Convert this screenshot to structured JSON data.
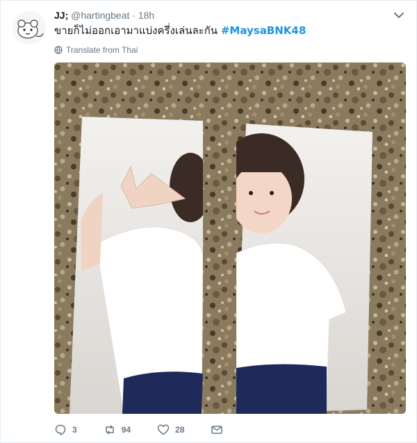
{
  "tweet": {
    "display_name": "JJ;",
    "handle": "@hartingbeat",
    "separator": "·",
    "time": "18h",
    "text": "ขายก็ไม่ออกเอามาแบ่งครึ่งเล่นละกัน",
    "hashtag": "#MaysaBNK48",
    "translate_label": "Translate from Thai",
    "media_description": "Two halves of a cut photo card of a girl in a white t-shirt posing with a peace sign, laid on granite countertop"
  },
  "actions": {
    "reply_count": "3",
    "retweet_count": "94",
    "like_count": "28"
  },
  "colors": {
    "accent": "#1b95e0",
    "muted": "#657786",
    "text": "#14171a"
  },
  "icons": [
    "avatar-image",
    "chevron-down-icon",
    "globe-icon",
    "reply-icon",
    "retweet-icon",
    "heart-icon",
    "message-icon"
  ]
}
